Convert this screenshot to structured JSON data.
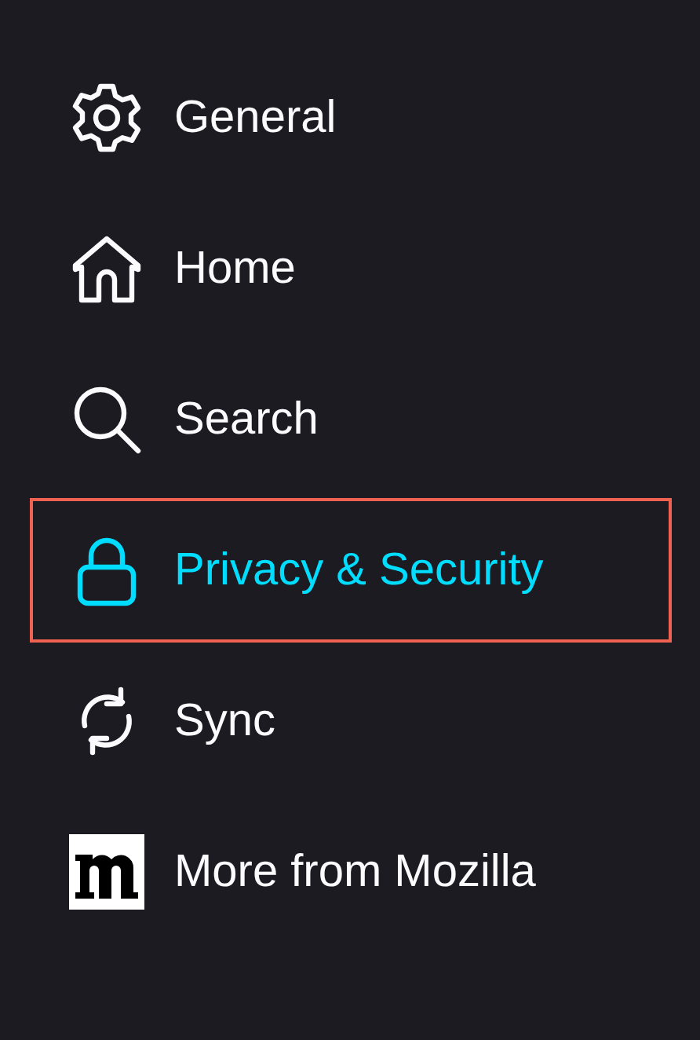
{
  "nav": {
    "items": [
      {
        "label": "General",
        "selected": false,
        "outlined": false
      },
      {
        "label": "Home",
        "selected": false,
        "outlined": false
      },
      {
        "label": "Search",
        "selected": false,
        "outlined": false
      },
      {
        "label": "Privacy & Security",
        "selected": true,
        "outlined": true
      },
      {
        "label": "Sync",
        "selected": false,
        "outlined": false
      },
      {
        "label": "More from Mozilla",
        "selected": false,
        "outlined": false
      }
    ]
  }
}
